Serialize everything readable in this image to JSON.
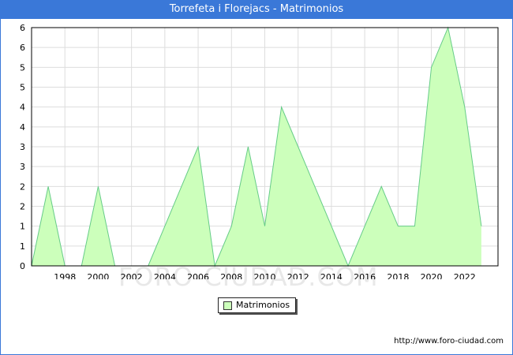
{
  "title": "Torrefeta i Florejacs - Matrimonios",
  "footer": "http://www.foro-ciudad.com",
  "watermark": "FORO-CIUDAD.COM",
  "colors": {
    "titlebar": "#3a78d8",
    "fill": "#ccffbb",
    "line": "#66cc88",
    "grid": "#dddddd"
  },
  "chart_data": {
    "type": "area",
    "title": "Torrefeta i Florejacs - Matrimonios",
    "x": [
      1996,
      1997,
      1998,
      1999,
      2000,
      2001,
      2002,
      2003,
      2004,
      2005,
      2006,
      2007,
      2008,
      2009,
      2010,
      2011,
      2012,
      2013,
      2014,
      2015,
      2016,
      2017,
      2018,
      2019,
      2020,
      2021,
      2022,
      2023
    ],
    "series": [
      {
        "name": "Matrimonios",
        "values": [
          0,
          2,
          0,
          0,
          2,
          0,
          0,
          0,
          1,
          2,
          3,
          0,
          1,
          3,
          1,
          4,
          3,
          2,
          1,
          0,
          1,
          2,
          1,
          1,
          5,
          6,
          4,
          1
        ]
      }
    ],
    "x_tick_labels": [
      "1998",
      "2000",
      "2002",
      "2004",
      "2006",
      "2008",
      "2010",
      "2012",
      "2014",
      "2016",
      "2018",
      "2020",
      "2022"
    ],
    "y_tick_labels": [
      "0",
      "1",
      "1",
      "2",
      "2",
      "3",
      "3",
      "4",
      "4",
      "5",
      "5",
      "6",
      "6"
    ],
    "xlim": [
      1996,
      2024
    ],
    "ylim": [
      0,
      6
    ],
    "grid": true,
    "legend_position": "bottom-center"
  }
}
